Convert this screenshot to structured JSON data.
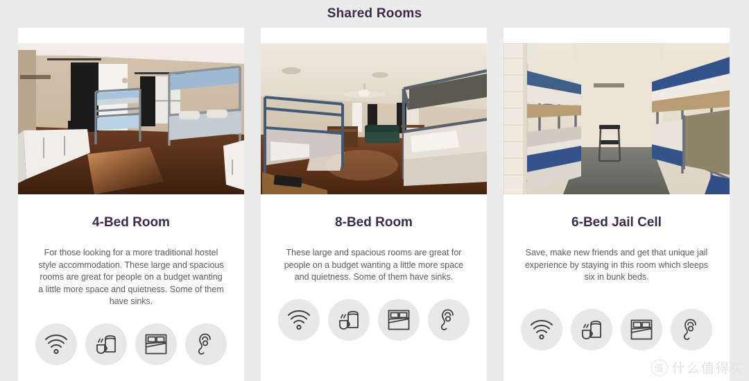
{
  "page": {
    "title": "Shared Rooms",
    "background_color": "#ebebeb",
    "heading_color": "#3d2a4b",
    "card_background": "#ffffff"
  },
  "watermark": {
    "badge": "值",
    "text": "什么值得买"
  },
  "amenity_icons": [
    {
      "name": "wifi-icon",
      "label": "Free WiFi"
    },
    {
      "name": "breakfast-icon",
      "label": "Breakfast"
    },
    {
      "name": "linen-bed-icon",
      "label": "Linen included"
    },
    {
      "name": "earplugs-icon",
      "label": "Earplugs / quiet"
    }
  ],
  "cards": [
    {
      "title": "4-Bed Room",
      "description": "For those looking for a more traditional hostel style accommodation. These large and spacious rooms are great for people on a budget wanting a little more space and quietness. Some of them have sinks.",
      "photo_alt": "Dorm room with metal bunk beds, dark curtains and wooden floor",
      "amenities": [
        "wifi-icon",
        "breakfast-icon",
        "linen-bed-icon",
        "earplugs-icon"
      ]
    },
    {
      "title": "8-Bed Room",
      "description": "These large and spacious rooms are great for people on a budget wanting a little more space and quietness. Some of them have sinks.",
      "photo_alt": "Large dorm room with two sets of bunk beds, sofa and ceiling fan",
      "amenities": [
        "wifi-icon",
        "breakfast-icon",
        "linen-bed-icon",
        "earplugs-icon"
      ]
    },
    {
      "title": "6-Bed Jail Cell",
      "description": "Save, make new friends and get that unique jail experience by staying in this room which sleeps six in bunk beds.",
      "photo_alt": "Narrow jail cell with bunk beds on both sides and a chair",
      "amenities": [
        "wifi-icon",
        "breakfast-icon",
        "linen-bed-icon",
        "earplugs-icon"
      ]
    }
  ]
}
